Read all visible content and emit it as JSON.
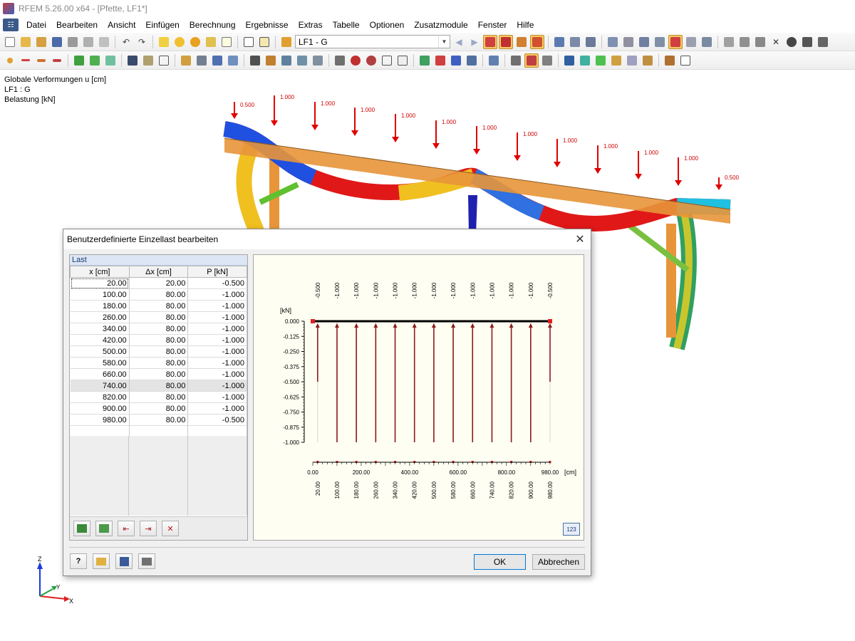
{
  "window": {
    "title": "RFEM 5.26.00 x64 - [Pfette, LF1*]"
  },
  "menu": {
    "items": [
      {
        "label": "Datei"
      },
      {
        "label": "Bearbeiten"
      },
      {
        "label": "Ansicht"
      },
      {
        "label": "Einfügen"
      },
      {
        "label": "Berechnung"
      },
      {
        "label": "Ergebnisse"
      },
      {
        "label": "Extras"
      },
      {
        "label": "Tabelle"
      },
      {
        "label": "Optionen"
      },
      {
        "label": "Zusatzmodule"
      },
      {
        "label": "Fenster"
      },
      {
        "label": "Hilfe"
      }
    ]
  },
  "toolbar": {
    "load_case": "LF1 - G"
  },
  "workspace": {
    "info": [
      "Globale Verformungen u [cm]",
      "LF1 : G",
      "Belastung [kN]"
    ],
    "loads_3d": [
      "0.500",
      "1.000",
      "1.000",
      "1.000",
      "1.000",
      "1.000",
      "1.000",
      "1.000",
      "1.000",
      "1.000",
      "1.000",
      "1.000",
      "0.500"
    ],
    "axes": {
      "z": "Z",
      "y": "Y",
      "x": "X"
    }
  },
  "dialog": {
    "title": "Benutzerdefinierte Einzellast bearbeiten",
    "panel_title": "Last",
    "columns": [
      "x [cm]",
      "Δx [cm]",
      "P [kN]"
    ],
    "rows": [
      [
        "20.00",
        "20.00",
        "-0.500"
      ],
      [
        "100.00",
        "80.00",
        "-1.000"
      ],
      [
        "180.00",
        "80.00",
        "-1.000"
      ],
      [
        "260.00",
        "80.00",
        "-1.000"
      ],
      [
        "340.00",
        "80.00",
        "-1.000"
      ],
      [
        "420.00",
        "80.00",
        "-1.000"
      ],
      [
        "500.00",
        "80.00",
        "-1.000"
      ],
      [
        "580.00",
        "80.00",
        "-1.000"
      ],
      [
        "660.00",
        "80.00",
        "-1.000"
      ],
      [
        "740.00",
        "80.00",
        "-1.000"
      ],
      [
        "820.00",
        "80.00",
        "-1.000"
      ],
      [
        "900.00",
        "80.00",
        "-1.000"
      ],
      [
        "980.00",
        "80.00",
        "-0.500"
      ]
    ],
    "selected_row": 9,
    "ok_label": "OK",
    "cancel_label": "Abbrechen"
  },
  "chart_data": {
    "type": "bar",
    "ylabel": "[kN]",
    "xlabel": "[cm]",
    "xlim": [
      0,
      980
    ],
    "ylim": [
      -1.0,
      0.0
    ],
    "y_ticks": [
      "0.000",
      "-0.125",
      "-0.250",
      "-0.375",
      "-0.500",
      "-0.625",
      "-0.750",
      "-0.875",
      "-1.000"
    ],
    "x_ticks": [
      "0.00",
      "200.00",
      "400.00",
      "600.00",
      "800.00",
      "980.00"
    ],
    "x": [
      20,
      100,
      180,
      260,
      340,
      420,
      500,
      580,
      660,
      740,
      820,
      900,
      980
    ],
    "x_labels": [
      "20.00",
      "100.00",
      "180.00",
      "260.00",
      "340.00",
      "420.00",
      "500.00",
      "580.00",
      "660.00",
      "740.00",
      "820.00",
      "900.00",
      "980.00"
    ],
    "values": [
      -0.5,
      -1.0,
      -1.0,
      -1.0,
      -1.0,
      -1.0,
      -1.0,
      -1.0,
      -1.0,
      -1.0,
      -1.0,
      -1.0,
      -0.5
    ],
    "value_labels": [
      "-0.500",
      "-1.000",
      "-1.000",
      "-1.000",
      "-1.000",
      "-1.000",
      "-1.000",
      "-1.000",
      "-1.000",
      "-1.000",
      "-1.000",
      "-1.000",
      "-0.500"
    ],
    "colors": {
      "bar": "#8b1a1a",
      "beam": "#000000",
      "support": "#e02020"
    }
  }
}
